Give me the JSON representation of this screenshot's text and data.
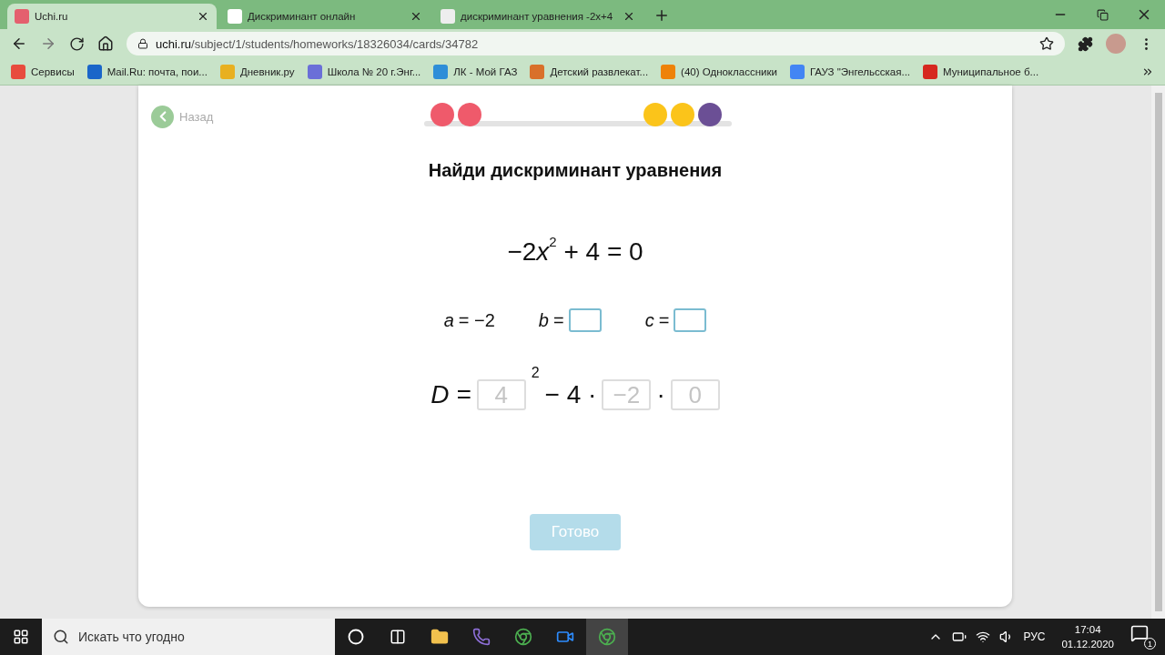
{
  "browser": {
    "tabs": [
      {
        "title": "Uchi.ru",
        "selected": true
      },
      {
        "title": "Дискриминант онлайн",
        "selected": false
      },
      {
        "title": "дискриминант уравнения -2x+4",
        "selected": false
      }
    ],
    "url_host": "uchi.ru",
    "url_path": "/subject/1/students/homeworks/18326034/cards/34782",
    "bookmarks": [
      {
        "label": "Сервисы",
        "color": "#e84c3d"
      },
      {
        "label": "Mail.Ru: почта, пои...",
        "color": "#1a66c9"
      },
      {
        "label": "Дневник.ру",
        "color": "#e8b020"
      },
      {
        "label": "Школа № 20 г.Энг...",
        "color": "#6a6fd8"
      },
      {
        "label": "ЛК - Мой ГАЗ",
        "color": "#2e8ed8"
      },
      {
        "label": "Детский развлекат...",
        "color": "#d9702a"
      },
      {
        "label": "(40) Одноклассники",
        "color": "#ee8208"
      },
      {
        "label": "ГАУЗ \"Энгельсская...",
        "color": "#4285f4"
      },
      {
        "label": "Муниципальное б...",
        "color": "#d6281f"
      }
    ]
  },
  "page": {
    "back_label": "Назад",
    "progress_left": [
      {
        "color": "#ef5a6b"
      },
      {
        "color": "#ef5a6b"
      }
    ],
    "progress_right": [
      {
        "color": "#fbc41a"
      },
      {
        "color": "#fbc41a"
      },
      {
        "color": "#6b4f95"
      }
    ],
    "title": "Найди дискриминант уравнения",
    "equation": [
      {
        "kind": "text",
        "text": "−2"
      },
      {
        "kind": "var",
        "text": "x"
      },
      {
        "kind": "sup",
        "text": "2"
      },
      {
        "kind": "text",
        "text": " + 4 = 0"
      }
    ],
    "coefficients": [
      {
        "name": "a",
        "kind": "value",
        "value": "= −2"
      },
      {
        "name": "b",
        "kind": "input",
        "value": "="
      },
      {
        "name": "c",
        "kind": "input",
        "value": "="
      }
    ],
    "formula": [
      {
        "kind": "var",
        "text": "D ="
      },
      {
        "kind": "field",
        "placeholder": "4"
      },
      {
        "kind": "sup",
        "text": "2"
      },
      {
        "kind": "op",
        "text": "− 4 ·"
      },
      {
        "kind": "field",
        "placeholder": "−2"
      },
      {
        "kind": "op",
        "text": "·"
      },
      {
        "kind": "field",
        "placeholder": "0"
      }
    ],
    "done_button": {
      "label": "Готово",
      "disabled": true
    }
  },
  "taskbar": {
    "search_placeholder": "Искать что угодно",
    "language": "РУС",
    "time": "17:04",
    "date": "01.12.2020",
    "notifications": "1"
  }
}
